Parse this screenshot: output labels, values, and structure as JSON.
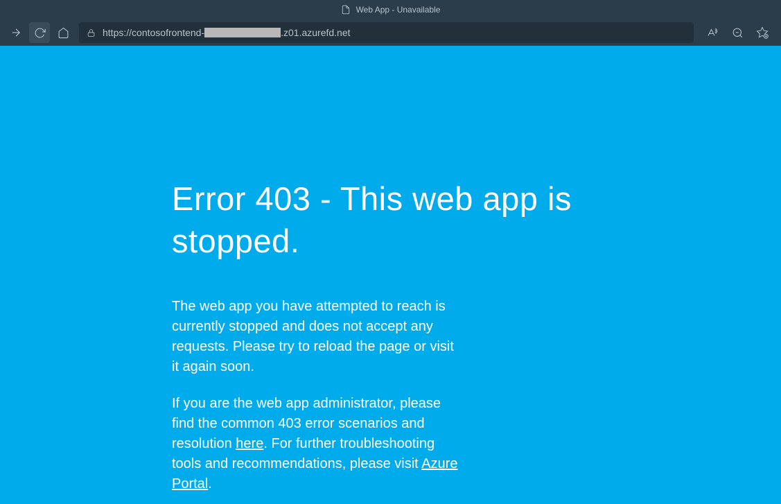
{
  "tab": {
    "title": "Web App - Unavailable"
  },
  "address": {
    "protocol": "https://",
    "host_prefix": "contosofrontend-",
    "host_suffix": ".z01.azurefd.net"
  },
  "error": {
    "title": "Error 403 - This web app is stopped.",
    "paragraph1": "The web app you have attempted to reach is currently stopped and does not accept any requests. Please try to reload the page or visit it again soon.",
    "paragraph2_part1": "If you are the web app administrator, please find the common 403 error scenarios and resolution ",
    "link_here": "here",
    "paragraph2_part2": ". For further troubleshooting tools and recommendations, please visit ",
    "link_portal": "Azure Portal",
    "paragraph2_part3": "."
  }
}
